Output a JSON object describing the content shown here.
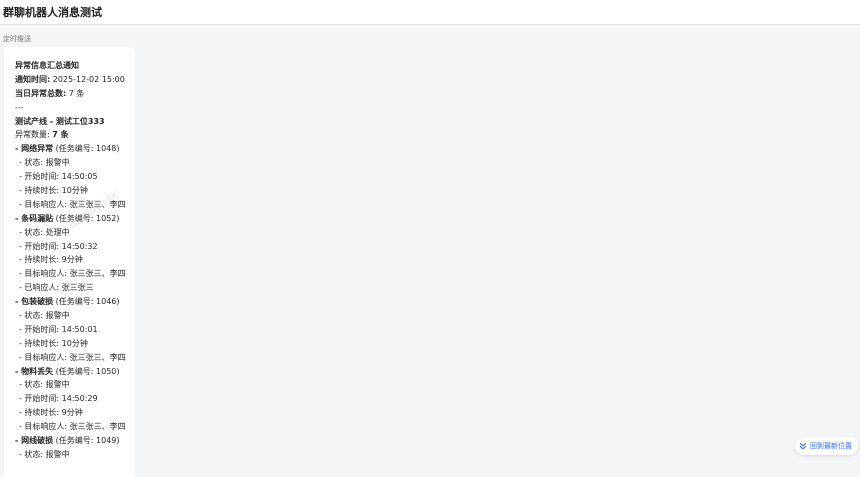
{
  "header": {
    "title": "群聊机器人消息测试"
  },
  "timestamp_label": "定时推送",
  "message": {
    "lines": [
      {
        "k": "异常信息汇总通知",
        "v": "",
        "bold": true,
        "indent": false
      },
      {
        "k": "通知时间:",
        "v": " 2025-12-02 15:00",
        "bold": true,
        "indent": false
      },
      {
        "k": "当日异常总数:",
        "v": " 7 条",
        "bold": true,
        "indent": false
      },
      {
        "k": "",
        "v": "---",
        "bold": false,
        "indent": false
      },
      {
        "k": "测试产线 - 测试工位333",
        "v": "",
        "bold": true,
        "indent": false
      },
      {
        "k": "异常数量: ",
        "v": "7 条",
        "bold": false,
        "indent": false,
        "bold_value": true
      },
      {
        "k": "- 网络异常",
        "v": " (任务编号: 1048)",
        "bold": true,
        "indent": false
      },
      {
        "k": "",
        "v": "- 状态: 报警中",
        "bold": false,
        "indent": true
      },
      {
        "k": "",
        "v": "- 开始时间: 14:50:05",
        "bold": false,
        "indent": true
      },
      {
        "k": "",
        "v": "- 持续时长: 10分钟",
        "bold": false,
        "indent": true
      },
      {
        "k": "",
        "v": "- 目标响应人: 张三张三、李四",
        "bold": false,
        "indent": true
      },
      {
        "k": "- 条码漏贴",
        "v": " (任务编号: 1052)",
        "bold": true,
        "indent": false
      },
      {
        "k": "",
        "v": "- 状态: 处理中",
        "bold": false,
        "indent": true
      },
      {
        "k": "",
        "v": "- 开始时间: 14:50:32",
        "bold": false,
        "indent": true
      },
      {
        "k": "",
        "v": "- 持续时长: 9分钟",
        "bold": false,
        "indent": true
      },
      {
        "k": "",
        "v": "- 目标响应人: 张三张三、李四",
        "bold": false,
        "indent": true
      },
      {
        "k": "",
        "v": "- 已响应人: 张三张三",
        "bold": false,
        "indent": true
      },
      {
        "k": "- 包装破损",
        "v": " (任务编号: 1046)",
        "bold": true,
        "indent": false
      },
      {
        "k": "",
        "v": "- 状态: 报警中",
        "bold": false,
        "indent": true
      },
      {
        "k": "",
        "v": "- 开始时间: 14:50:01",
        "bold": false,
        "indent": true
      },
      {
        "k": "",
        "v": "- 持续时长: 10分钟",
        "bold": false,
        "indent": true
      },
      {
        "k": "",
        "v": "- 目标响应人: 张三张三、李四",
        "bold": false,
        "indent": true
      },
      {
        "k": "- 物料丢失",
        "v": " (任务编号: 1050)",
        "bold": true,
        "indent": false
      },
      {
        "k": "",
        "v": "- 状态: 报警中",
        "bold": false,
        "indent": true
      },
      {
        "k": "",
        "v": "- 开始时间: 14:50:29",
        "bold": false,
        "indent": true
      },
      {
        "k": "",
        "v": "- 持续时长: 9分钟",
        "bold": false,
        "indent": true
      },
      {
        "k": "",
        "v": "- 目标响应人: 张三张三、李四",
        "bold": false,
        "indent": true
      },
      {
        "k": "- 网线破损",
        "v": " (任务编号: 1049)",
        "bold": true,
        "indent": false
      },
      {
        "k": "",
        "v": "- 状态: 报警中",
        "bold": false,
        "indent": true
      }
    ]
  },
  "jump_button": {
    "label": "回到最新位置",
    "icon": "double-chevron-down-icon"
  },
  "colors": {
    "accent": "#3370ff",
    "background": "#f4f5f7",
    "bubble": "#ffffff"
  }
}
